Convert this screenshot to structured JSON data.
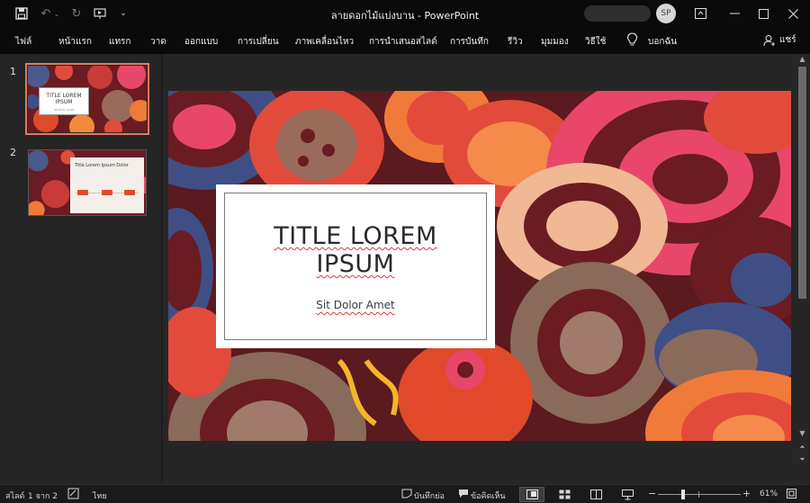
{
  "app": {
    "document_name": "ลายดอกไม้แบ่งบาน",
    "separator": " - ",
    "app_name": "PowerPoint",
    "avatar_initials": "SP"
  },
  "ribbon": {
    "tabs": [
      "ไฟล์",
      "หน้าแรก",
      "แทรก",
      "วาด",
      "ออกแบบ",
      "การเปลี่ยน",
      "ภาพเคลื่อนไหว",
      "การนำเสนอสไลด์",
      "การบันทึก",
      "รีวิว",
      "มุมมอง",
      "วิธีใช้"
    ],
    "tell_me": "บอกฉัน",
    "share": "แชร์"
  },
  "thumbnails": [
    {
      "number": "1",
      "title": "TITLE LOREM IPSUM",
      "subtitle": "Sit Dolor Amet",
      "selected": true
    },
    {
      "number": "2",
      "title": "Title Lorem Ipsum Dolor",
      "selected": false
    }
  ],
  "slide": {
    "title_line1": "TITLE LOREM",
    "title_line2": "IPSUM",
    "subtitle": "Sit Dolor Amet"
  },
  "status": {
    "slide_label": "สไลด์",
    "slide_position": "1 จาก 2",
    "language": "ไทย",
    "notes": "บันทึกย่อ",
    "comments": "ข้อคิดเห็น",
    "zoom_minus": "−",
    "zoom_plus": "+",
    "zoom": "61%"
  },
  "colors": {
    "accent_selection": "#e07a5f",
    "slide_bg": "#5a1a1f"
  }
}
